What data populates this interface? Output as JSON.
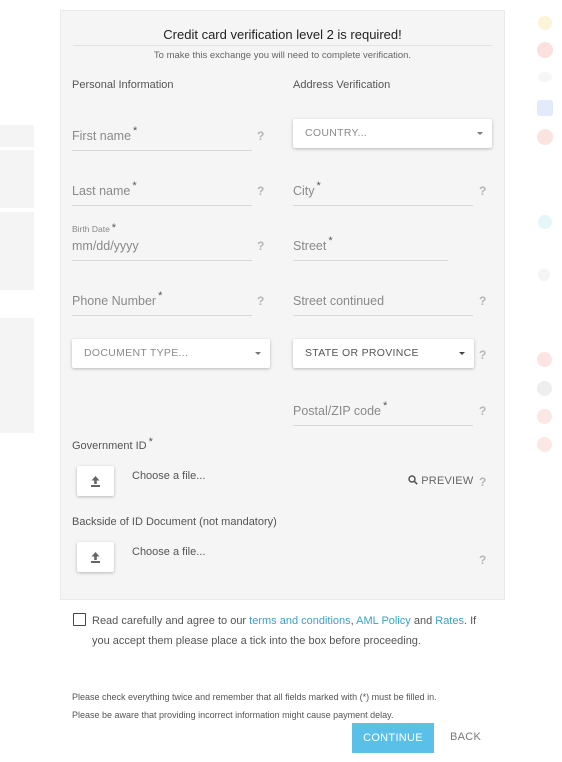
{
  "header": {
    "title": "Credit card verification level 2 is required!",
    "subtitle": "To make this exchange you will need to complete verification."
  },
  "personal": {
    "heading": "Personal Information",
    "first_name": "First name",
    "last_name": "Last name",
    "birth_label": "Birth Date",
    "birth_placeholder": "mm/dd/yyyy",
    "phone": "Phone Number",
    "document_type": "DOCUMENT TYPE..."
  },
  "address": {
    "heading": "Address Verification",
    "country": "COUNTRY...",
    "city": "City",
    "street": "Street",
    "street2": "Street continued",
    "state": "STATE OR PROVINCE",
    "zip": "Postal/ZIP code"
  },
  "required_mark": "*",
  "help_mark": "?",
  "uploads": {
    "gov_label": "Government ID",
    "choose_file": "Choose a file...",
    "preview": "PREVIEW",
    "back_label": "Backside of ID Document (not mandatory)"
  },
  "agree": {
    "prefix": "Read carefully and agree to our ",
    "terms": "terms and conditions",
    "comma": ", ",
    "aml": "AML Policy",
    "and": " and ",
    "rates": "Rates",
    "suffix": ". If you accept them please place a tick into the box before proceeding."
  },
  "notes": {
    "line1": "Please check everything twice and remember that all fields marked with (*) must be filled in.",
    "line2": "Please be aware that providing incorrect information might cause payment delay."
  },
  "actions": {
    "continue": "CONTINUE",
    "back": "BACK"
  },
  "colors": {
    "accent": "#5bc0e8",
    "link": "#3aa1c8"
  }
}
